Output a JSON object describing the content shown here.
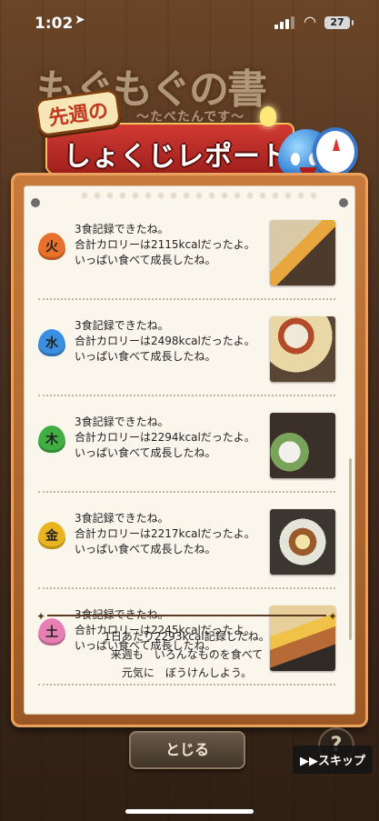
{
  "status_bar": {
    "time": "1:02",
    "battery": "27"
  },
  "header": {
    "app_title": "もぐもぐの書",
    "app_subtitle": "〜たべたんです〜",
    "banner_top": "先週の",
    "banner_title": "しょくじレポート"
  },
  "days": [
    {
      "label": "火",
      "color": "#e7702b",
      "line1": "3食記録できたね。",
      "line2": "合計カロリーは2115kcalだったよ。",
      "line3": "いっぱい食べて成長したね。"
    },
    {
      "label": "水",
      "color": "#3a8fe0",
      "line1": "3食記録できたね。",
      "line2": "合計カロリーは2498kcalだったよ。",
      "line3": "いっぱい食べて成長したね。"
    },
    {
      "label": "木",
      "color": "#3fae43",
      "line1": "3食記録できたね。",
      "line2": "合計カロリーは2294kcalだったよ。",
      "line3": "いっぱい食べて成長したね。"
    },
    {
      "label": "金",
      "color": "#e9b420",
      "line1": "3食記録できたね。",
      "line2": "合計カロリーは2217kcalだったよ。",
      "line3": "いっぱい食べて成長したね。"
    },
    {
      "label": "土",
      "color": "#e77fb4",
      "line1": "3食記録できたね。",
      "line2": "合計カロリーは2245kcalだったよ。",
      "line3": "いっぱい食べて成長したね。"
    }
  ],
  "summary": {
    "line1": "1日あたり2293kcal記録したね。",
    "line2": "来週も　いろんなものを食べて",
    "line3": "元気に　ぼうけんしよう。"
  },
  "buttons": {
    "close": "とじる",
    "help": "?",
    "skip": "▶▶スキップ"
  }
}
